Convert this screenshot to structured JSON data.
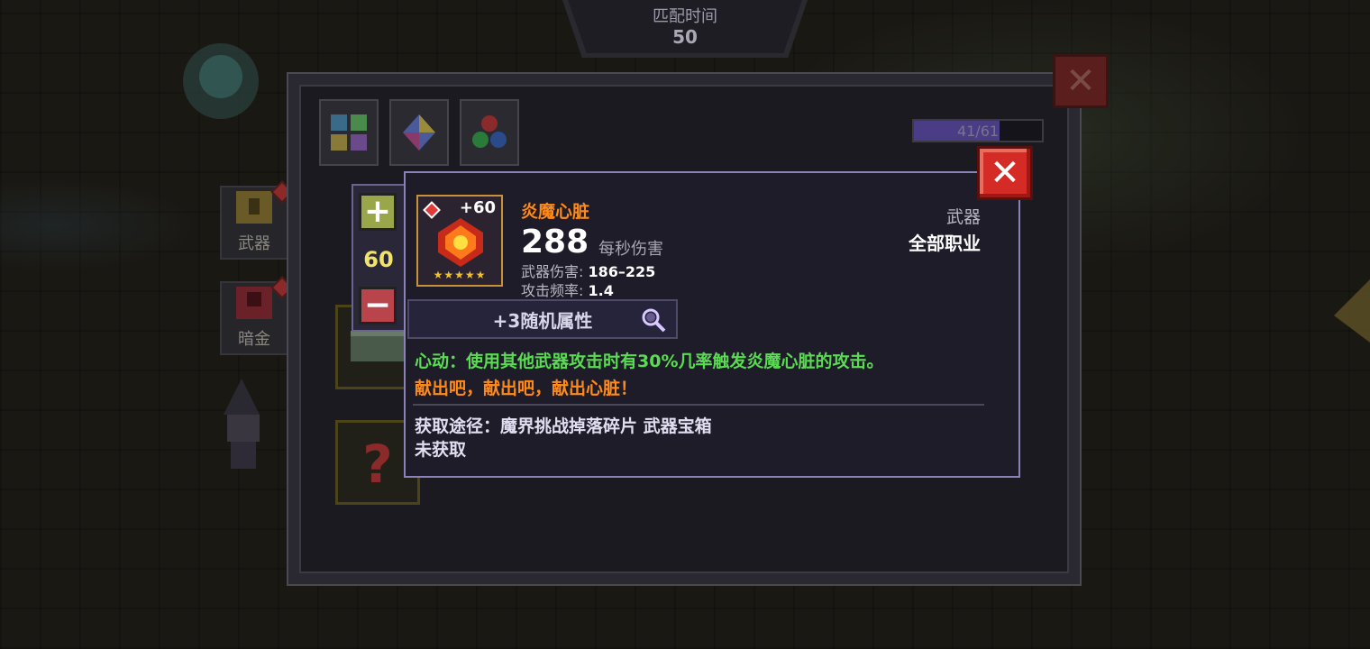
{
  "match_timer": {
    "label": "匹配时间",
    "value": "50"
  },
  "side_categories": [
    {
      "label": "武器"
    },
    {
      "label": "暗金"
    }
  ],
  "progress": {
    "text": "41/61",
    "current": 41,
    "max": 61
  },
  "stepper": {
    "value": "60",
    "plus": "+",
    "minus": "−"
  },
  "item": {
    "name": "炎魔心脏",
    "level": "+60",
    "stars": "★★★★★",
    "dps": "288",
    "dps_label": "每秒伤害",
    "damage_label": "武器伤害:",
    "damage_value": "186–225",
    "rate_label": "攻击频率:",
    "rate_value": "1.4",
    "type": "武器",
    "class": "全部职业",
    "random_attr": "+3随机属性",
    "passive": "心动：使用其他武器攻击时有30%几率触发炎魔心脏的攻击。",
    "flavor": "献出吧，献出吧，献出心脏！",
    "source": "获取途径：魔界挑战掉落碎片 武器宝箱",
    "status": "未获取"
  },
  "colors": {
    "item_name": "#ff8a1a",
    "passive": "#5adc52",
    "close_red": "#d52b26",
    "progress_fill": "#4a3d86",
    "stepper_value": "#f0e36a"
  },
  "icons": {
    "close": "close-icon",
    "magnifier": "magnifier-icon",
    "plus": "plus-icon",
    "minus": "minus-icon"
  }
}
